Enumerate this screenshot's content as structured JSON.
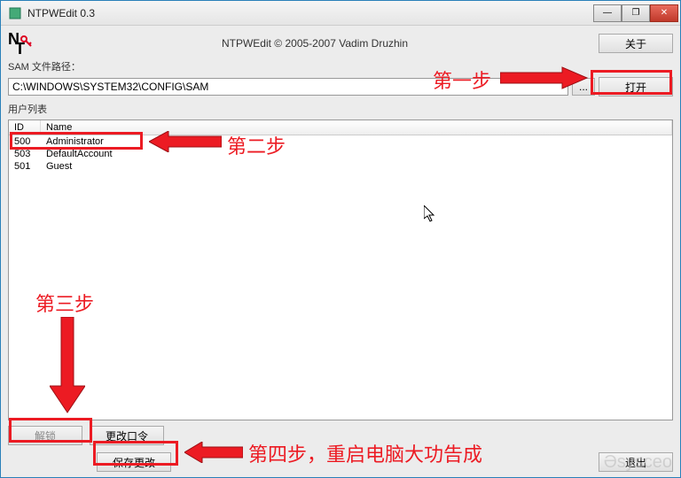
{
  "window": {
    "title": "NTPWEdit 0.3",
    "minimize": "—",
    "maximize": "❐",
    "close": "✕"
  },
  "header": {
    "copyright": "NTPWEdit © 2005-2007 Vadim Druzhin",
    "about_btn": "关于"
  },
  "path": {
    "label": "SAM 文件路径：",
    "value": "C:\\WINDOWS\\SYSTEM32\\CONFIG\\SAM",
    "browse": "...",
    "open_btn": "打开"
  },
  "userlist": {
    "label": "用户列表",
    "headers": {
      "id": "ID",
      "name": "Name"
    },
    "rows": [
      {
        "id": "500",
        "name": "Administrator"
      },
      {
        "id": "503",
        "name": "DefaultAccount"
      },
      {
        "id": "501",
        "name": "Guest"
      }
    ]
  },
  "buttons": {
    "unlock": "解锁",
    "change_pw": "更改口令",
    "save": "保存更改",
    "exit": "退出"
  },
  "annotations": {
    "step1": "第一步",
    "step2": "第二步",
    "step3": "第三步",
    "step4": "第四步，重启电脑大功告成"
  },
  "watermark": "Əsysceo"
}
